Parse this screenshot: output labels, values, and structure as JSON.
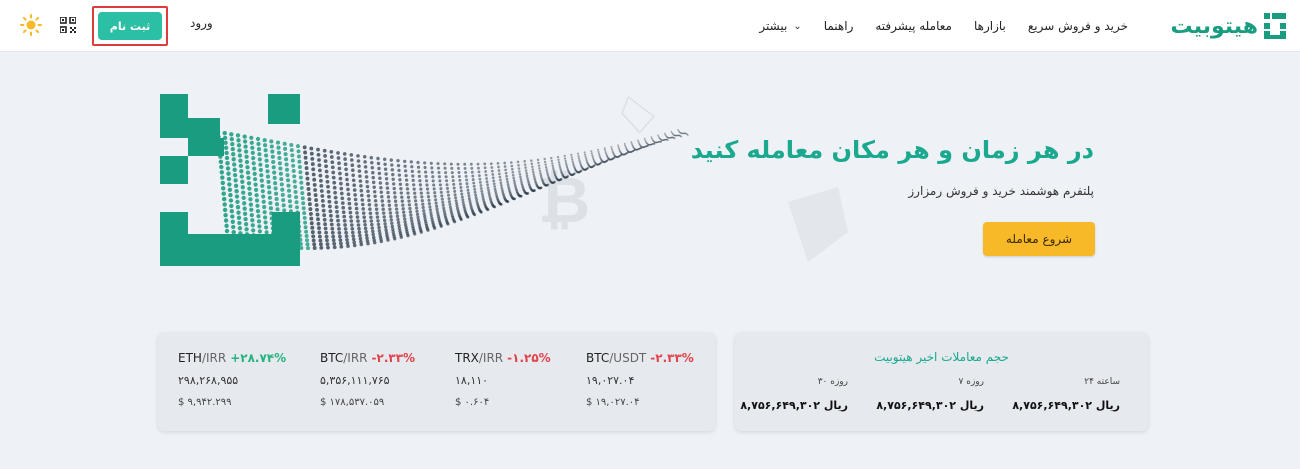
{
  "header": {
    "logo_text": "هیتوبیت",
    "nav": [
      "خرید و فروش سریع",
      "بازارها",
      "معامله پیشرفته",
      "راهنما",
      "بیشتر"
    ],
    "signup_label": "ثبت نام",
    "login_label": "ورود"
  },
  "hero": {
    "title": "در هر زمان و هر مکان معامله کنید",
    "subtitle": "پلتفرم هوشمند خرید و فروش رمزارز",
    "cta_label": "شروع معامله"
  },
  "colors": {
    "brand": "#1aa98e",
    "signup_bg": "#2bbfa6",
    "cta_bg": "#f7b928",
    "positive": "#24b47e",
    "negative": "#e0434a"
  },
  "prices": [
    {
      "base": "ETH",
      "quote": "/IRR",
      "change": "+۲۸.۷۴%",
      "direction": "up",
      "price": "۲۹۸,۲۶۸,۹۵۵",
      "usd": "$ ۹,۹۴۲.۲۹۹"
    },
    {
      "base": "BTC",
      "quote": "/IRR",
      "change": "-۲.۳۳%",
      "direction": "down",
      "price": "۵,۳۵۶,۱۱۱,۷۶۵",
      "usd": "$ ۱۷۸,۵۳۷.۰۵۹"
    },
    {
      "base": "TRX",
      "quote": "/IRR",
      "change": "-۱.۲۵%",
      "direction": "down",
      "price": "۱۸,۱۱۰",
      "usd": "$ ۰.۶۰۴"
    },
    {
      "base": "BTC",
      "quote": "/USDT",
      "change": "-۲.۳۳%",
      "direction": "down",
      "price": "۱۹,۰۲۷.۰۴",
      "usd": "$ ۱۹,۰۲۷.۰۴"
    }
  ],
  "volume": {
    "title": "حجم معاملات اخیر هیتوبیت",
    "periods": [
      {
        "label": "۲۴ ساعته",
        "value": "۸,۷۵۶,۶۴۹,۳۰۲ ریال"
      },
      {
        "label": "۷ روزه",
        "value": "۸,۷۵۶,۶۴۹,۳۰۲ ریال"
      },
      {
        "label": "۳۰ روزه",
        "value": "۸,۷۵۶,۶۴۹,۳۰۲ ریال"
      }
    ]
  }
}
